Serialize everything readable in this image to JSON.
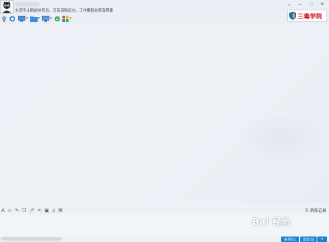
{
  "title": {
    "signature": "生活不止眼前的苟且，还有诗和远方。工作要有效率有质量"
  },
  "window_controls": [
    "chevron-down-icon",
    "minimize-icon",
    "maximize-icon",
    "close-icon"
  ],
  "banner": {
    "text": "三毒学院",
    "accent": "#d0141c"
  },
  "toolbar_icons": [
    "webcam-icon",
    "voice-call-icon",
    "remote-desktop-icon",
    "file-transfer-icon",
    "screen-share-icon",
    "app-icon",
    "more-apps-icon"
  ],
  "input_toolbar_icons": [
    "font-icon",
    "emoji-icon",
    "scissors-icon",
    "window-icon",
    "microphone-icon",
    "edit-icon",
    "image-icon",
    "music-icon",
    "shake-icon"
  ],
  "history": {
    "label": "消息记录"
  },
  "watermark": {
    "text": "Bai 经验"
  },
  "buttons": {
    "close": "关闭(C)",
    "send": "发送(S)"
  },
  "colors": {
    "background": "#eef1f6",
    "accent_blue": "#1d82d0"
  }
}
